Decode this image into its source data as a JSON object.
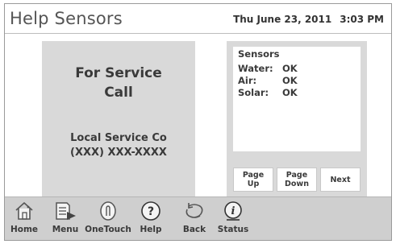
{
  "header": {
    "title": "Help Sensors",
    "date": "Thu June 23, 2011",
    "time": "3:03 PM"
  },
  "service": {
    "heading_line1": "For Service",
    "heading_line2": "Call",
    "company": "Local Service Co",
    "phone": "(XXX) XXX-XXXX"
  },
  "sensors": {
    "title": "Sensors",
    "rows": [
      {
        "name": "Water:",
        "status": "OK"
      },
      {
        "name": "Air:",
        "status": "OK"
      },
      {
        "name": "Solar:",
        "status": "OK"
      }
    ]
  },
  "pager": {
    "page_up": "Page\nUp",
    "page_down": "Page\nDown",
    "next": "Next"
  },
  "nav": {
    "items": [
      {
        "label": "Home",
        "icon": "home-icon"
      },
      {
        "label": "Menu",
        "icon": "menu-icon"
      },
      {
        "label": "OneTouch",
        "icon": "onetouch-icon"
      },
      {
        "label": "Help",
        "icon": "help-icon"
      },
      {
        "label": "Back",
        "icon": "back-icon"
      },
      {
        "label": "Status",
        "icon": "status-icon"
      }
    ]
  },
  "colors": {
    "panel": "#d9d9d9",
    "navbar": "#cfcfcf",
    "text": "#3a3a3a"
  }
}
